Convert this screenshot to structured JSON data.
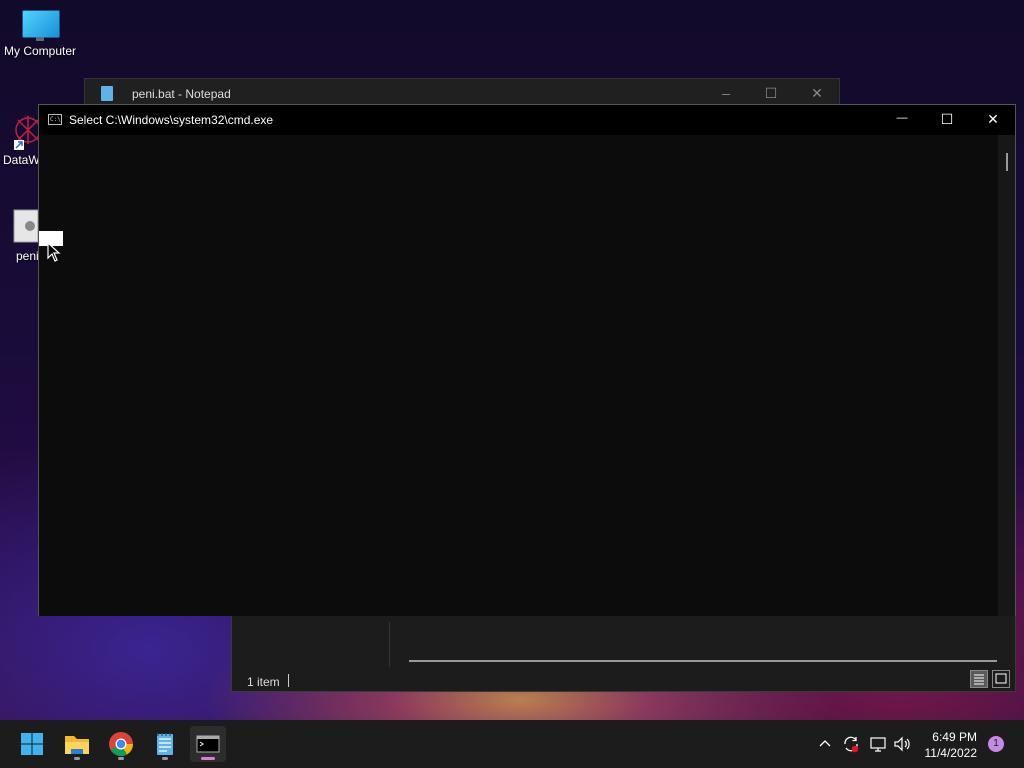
{
  "desktop": {
    "icons": [
      {
        "label": "My Computer",
        "icon": "monitor-icon"
      },
      {
        "label": "DataW",
        "icon": "app-shortcut-icon"
      },
      {
        "label": "peni",
        "icon": "batch-file-icon"
      }
    ]
  },
  "notepad": {
    "title": "peni.bat - Notepad",
    "minimize": "–",
    "maximize": "☐",
    "close": "✕"
  },
  "cmd": {
    "title": "Select C:\\Windows\\system32\\cmd.exe",
    "icon_text": "C:\\",
    "minimize": "—",
    "maximize": "☐",
    "close": "✕"
  },
  "explorer": {
    "status": "1 item",
    "view_details": "details-view-icon",
    "view_large": "large-icons-view-icon"
  },
  "taskbar": {
    "apps": [
      {
        "name": "start",
        "icon": "windows-start-icon"
      },
      {
        "name": "file-explorer",
        "icon": "folder-icon"
      },
      {
        "name": "chrome",
        "icon": "chrome-icon"
      },
      {
        "name": "notepad",
        "icon": "notepad-icon"
      },
      {
        "name": "terminal",
        "icon": "terminal-icon"
      }
    ],
    "clock_time": "6:49 PM",
    "clock_date": "11/4/2022",
    "notification_count": "1",
    "tray_icons": [
      "chevron-up-icon",
      "sync-icon",
      "network-icon",
      "volume-icon"
    ]
  },
  "colors": {
    "accent": "#d77fd0",
    "cmd_bg": "#0c0c0c",
    "taskbar_bg": "#1c1c1c"
  }
}
